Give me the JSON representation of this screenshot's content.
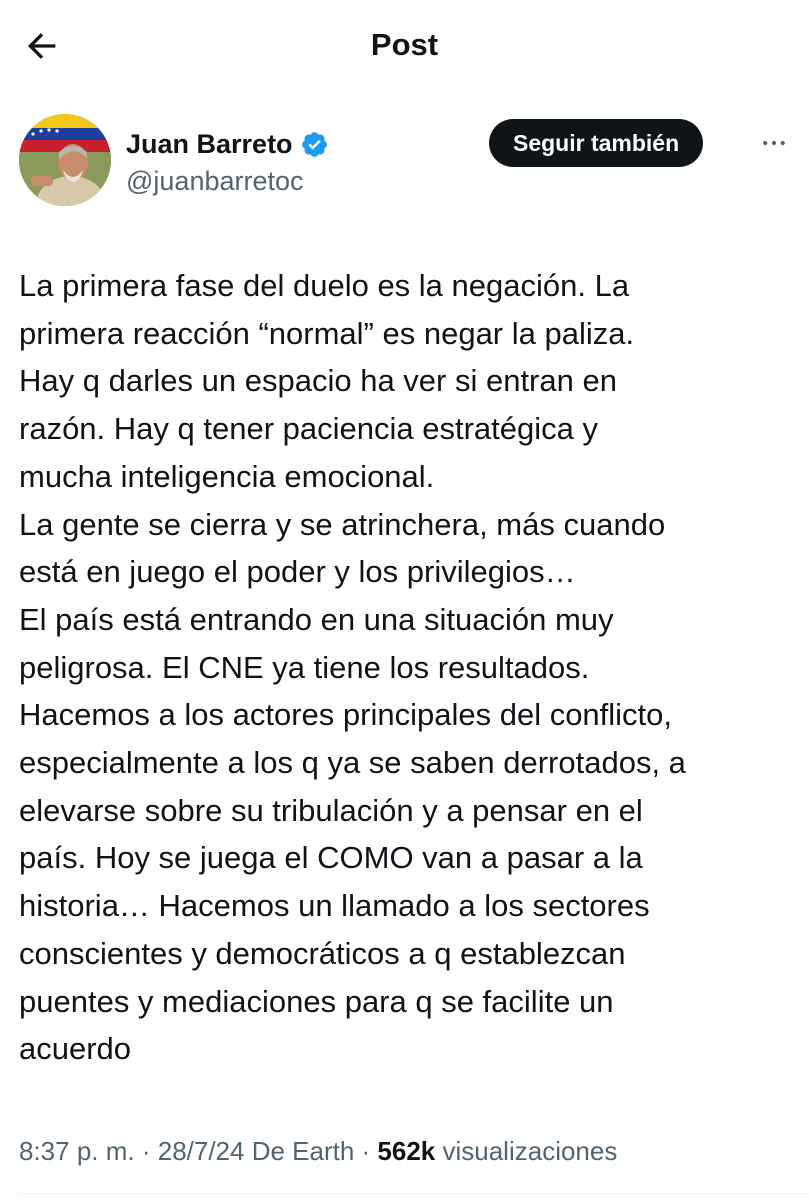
{
  "header": {
    "title": "Post",
    "back_icon": "arrow-left-icon"
  },
  "author": {
    "display_name": "Juan Barreto",
    "handle": "@juanbarretoc",
    "verified": true,
    "verified_color": "#1d9bf0",
    "follow_label": "Seguir también",
    "more_icon": "more-horizontal-icon"
  },
  "post": {
    "lines": [
      "La primera fase del duelo es la negación. La",
      "primera reacción “normal” es negar la paliza.",
      "Hay q darles un espacio ha ver si entran en",
      "razón. Hay q tener paciencia estratégica y",
      "mucha inteligencia emocional.",
      "La gente se cierra y se atrinchera, más cuando",
      "está en juego el poder y los privilegios…",
      "El país está entrando en una situación muy",
      "peligrosa. El CNE ya tiene los resultados.",
      "Hacemos a los actores principales del conflicto,",
      "especialmente a los q ya se saben derrotados, a",
      "elevarse sobre su tribulación y a pensar en el",
      "país. Hoy se juega el COMO van a pasar a la",
      "historia… Hacemos un llamado a los sectores",
      "conscientes y democráticos a q establezcan",
      "puentes y mediaciones para q se facilite un",
      "acuerdo"
    ]
  },
  "meta": {
    "time": "8:37 p. m.",
    "separator": " · ",
    "date": "28/7/24",
    "source": " De Earth",
    "views_count": "562k",
    "views_label": " visualizaciones"
  },
  "colors": {
    "text": "#0f1419",
    "secondary": "#536471",
    "button_bg": "#0f1419"
  }
}
